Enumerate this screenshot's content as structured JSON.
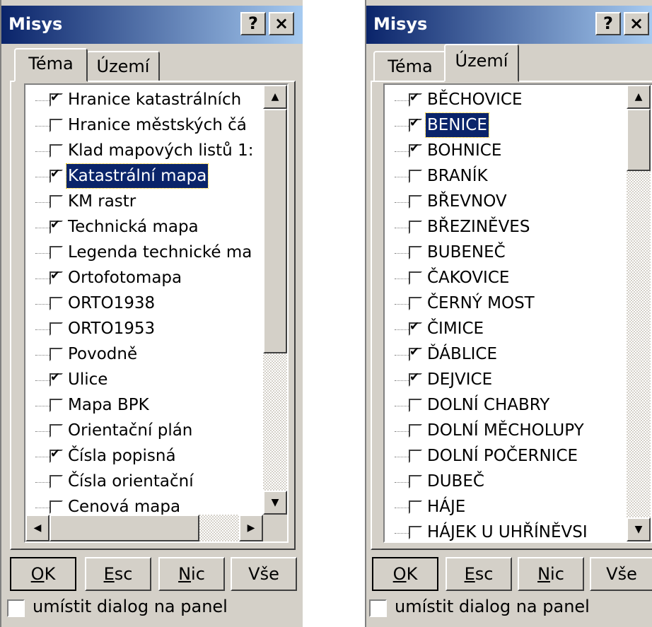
{
  "dialogs": [
    {
      "title": "Misys",
      "help_label": "?",
      "close_label": "×",
      "tabs": [
        {
          "label": "Téma",
          "active": true
        },
        {
          "label": "Území",
          "active": false
        }
      ],
      "items": [
        {
          "label": "Hranice katastrálních",
          "checked": true,
          "selected": false
        },
        {
          "label": "Hranice městských čá",
          "checked": false,
          "selected": false
        },
        {
          "label": "Klad mapových listů 1:",
          "checked": false,
          "selected": false
        },
        {
          "label": "Katastrální mapa",
          "checked": true,
          "selected": true
        },
        {
          "label": "KM rastr",
          "checked": false,
          "selected": false
        },
        {
          "label": "Technická mapa",
          "checked": true,
          "selected": false
        },
        {
          "label": "Legenda technické ma",
          "checked": false,
          "selected": false
        },
        {
          "label": "Ortofotomapa",
          "checked": true,
          "selected": false
        },
        {
          "label": "ORTO1938",
          "checked": false,
          "selected": false
        },
        {
          "label": "ORTO1953",
          "checked": false,
          "selected": false
        },
        {
          "label": "Povodně",
          "checked": false,
          "selected": false
        },
        {
          "label": "Ulice",
          "checked": true,
          "selected": false
        },
        {
          "label": "Mapa BPK",
          "checked": false,
          "selected": false
        },
        {
          "label": "Orientační plán",
          "checked": false,
          "selected": false
        },
        {
          "label": "Čísla popisná",
          "checked": true,
          "selected": false
        },
        {
          "label": "Čísla orientační",
          "checked": false,
          "selected": false
        },
        {
          "label": "Cenová mapa",
          "checked": false,
          "selected": false
        }
      ],
      "buttons": [
        {
          "underlined": "O",
          "rest": "K"
        },
        {
          "underlined": "E",
          "rest": "sc"
        },
        {
          "underlined": "N",
          "rest": "ic"
        },
        {
          "underlined": "",
          "rest": "Vše"
        }
      ],
      "bottom_checkbox_label": "umístit dialog na panel"
    },
    {
      "title": "Misys",
      "help_label": "?",
      "close_label": "×",
      "tabs": [
        {
          "label": "Téma",
          "active": false
        },
        {
          "label": "Území",
          "active": true
        }
      ],
      "items": [
        {
          "label": "BĚCHOVICE",
          "checked": true,
          "selected": false
        },
        {
          "label": "BENICE",
          "checked": true,
          "selected": true
        },
        {
          "label": "BOHNICE",
          "checked": true,
          "selected": false
        },
        {
          "label": "BRANÍK",
          "checked": false,
          "selected": false
        },
        {
          "label": "BŘEVNOV",
          "checked": false,
          "selected": false
        },
        {
          "label": "BŘEZINĚVES",
          "checked": false,
          "selected": false
        },
        {
          "label": "BUBENEČ",
          "checked": false,
          "selected": false
        },
        {
          "label": "ČAKOVICE",
          "checked": false,
          "selected": false
        },
        {
          "label": "ČERNÝ MOST",
          "checked": false,
          "selected": false
        },
        {
          "label": "ČIMICE",
          "checked": true,
          "selected": false
        },
        {
          "label": "ĎÁBLICE",
          "checked": true,
          "selected": false
        },
        {
          "label": "DEJVICE",
          "checked": true,
          "selected": false
        },
        {
          "label": "DOLNÍ CHABRY",
          "checked": false,
          "selected": false
        },
        {
          "label": "DOLNÍ MĚCHOLUPY",
          "checked": false,
          "selected": false
        },
        {
          "label": "DOLNÍ POČERNICE",
          "checked": false,
          "selected": false
        },
        {
          "label": "DUBEČ",
          "checked": false,
          "selected": false
        },
        {
          "label": "HÁJE",
          "checked": false,
          "selected": false
        },
        {
          "label": "HÁJEK U UHŘÍNĚVSI",
          "checked": false,
          "selected": false
        }
      ],
      "buttons": [
        {
          "underlined": "O",
          "rest": "K"
        },
        {
          "underlined": "E",
          "rest": "sc"
        },
        {
          "underlined": "N",
          "rest": "ic"
        },
        {
          "underlined": "",
          "rest": "Vše"
        }
      ],
      "bottom_checkbox_label": "umístit dialog na panel"
    }
  ],
  "colors": {
    "face": "#d4d0c8",
    "title_start": "#0a246a",
    "title_end": "#a6caf0",
    "selection": "#0a246a"
  }
}
